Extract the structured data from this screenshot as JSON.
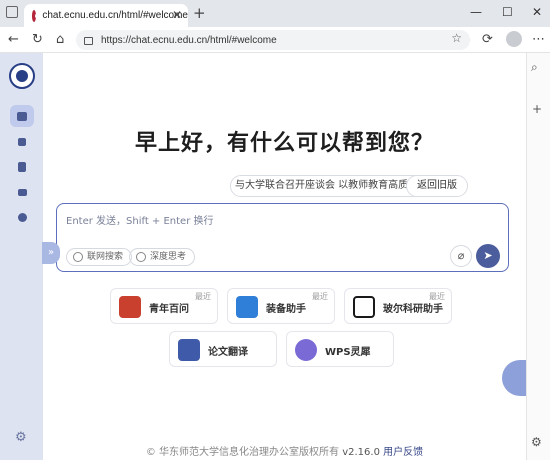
{
  "browser": {
    "tab_title": "chat.ecnu.edu.cn/html/#welcome",
    "url": "https://chat.ecnu.edu.cn/html/#welcome",
    "new_tab": "+",
    "close_tab": "✕",
    "min": "—",
    "max": "☐",
    "close": "✕"
  },
  "main": {
    "greeting": "早上好，有什么可以帮到您？",
    "notice": "与大学联合召开座谈会 以教师教育高质量发展推",
    "back_button": "返回旧版",
    "input_placeholder": "Enter 发送，Shift + Enter 换行",
    "web_search": "联网搜索",
    "deep_think": "深度思考",
    "cards": [
      {
        "label": "青年百问",
        "tag": "最近",
        "color": "#c9402f"
      },
      {
        "label": "装备助手",
        "tag": "最近",
        "color": "#2f7fd9"
      },
      {
        "label": "玻尔科研助手",
        "tag": "最近",
        "color": "#1a1a1a"
      },
      {
        "label": "论文翻译",
        "tag": "",
        "color": "#3f5aa8"
      },
      {
        "label": "WPS灵犀",
        "tag": "",
        "color": "#7a6ad6"
      }
    ],
    "footer_copyright": "© 华东师范大学信息化治理办公室版权所有",
    "footer_version": "v2.16.0",
    "footer_feedback": "用户反馈"
  },
  "colors": {
    "accent": "#4c5d9e",
    "sidebar_bg": "#dde3f1"
  }
}
